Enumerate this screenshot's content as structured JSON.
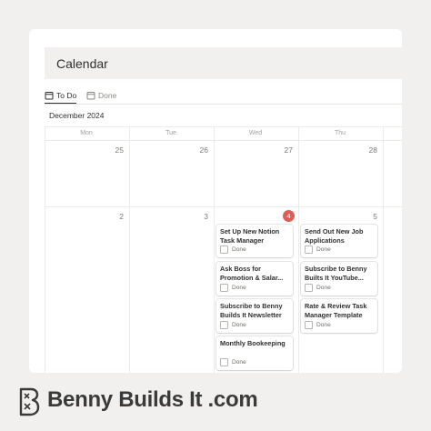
{
  "header": {
    "title": "Calendar"
  },
  "tabs": [
    {
      "label": "To Do",
      "icon": "calendar-icon",
      "active": true
    },
    {
      "label": "Done",
      "icon": "calendar-icon",
      "active": false
    }
  ],
  "month": "December 2024",
  "weekdays": [
    "Mon",
    "Tue",
    "Wed",
    "Thu"
  ],
  "weeks": [
    {
      "days": [
        "25",
        "26",
        "27",
        "28"
      ]
    },
    {
      "days": [
        "2",
        "3",
        "4",
        "5"
      ]
    }
  ],
  "today": "4",
  "tasks": {
    "wed": [
      {
        "title": "Set Up New Notion Task Manager",
        "done_label": "Done",
        "done": false
      },
      {
        "title": "Ask Boss for Promotion & Salar...",
        "done_label": "Done",
        "done": false
      },
      {
        "title": "Subscribe to Benny Builds It Newsletter",
        "done_label": "Done",
        "done": false
      },
      {
        "title": "Monthly Bookeeping",
        "done_label": "Done",
        "done": false
      }
    ],
    "thu": [
      {
        "title": "Send Out New Job Applications",
        "done_label": "Done",
        "done": false
      },
      {
        "title": "Subscribe to Benny Builts It YouTube...",
        "done_label": "Done",
        "done": false
      },
      {
        "title": "Rate & Review Task Manager Template",
        "done_label": "Done",
        "done": false
      }
    ]
  },
  "footer": {
    "brand": "Benny Builds It .com",
    "logo_icon": "benny-logo-icon"
  },
  "colors": {
    "today": "#e25c55",
    "background": "#f1f0ee",
    "header_bg": "#f1f0ee"
  }
}
